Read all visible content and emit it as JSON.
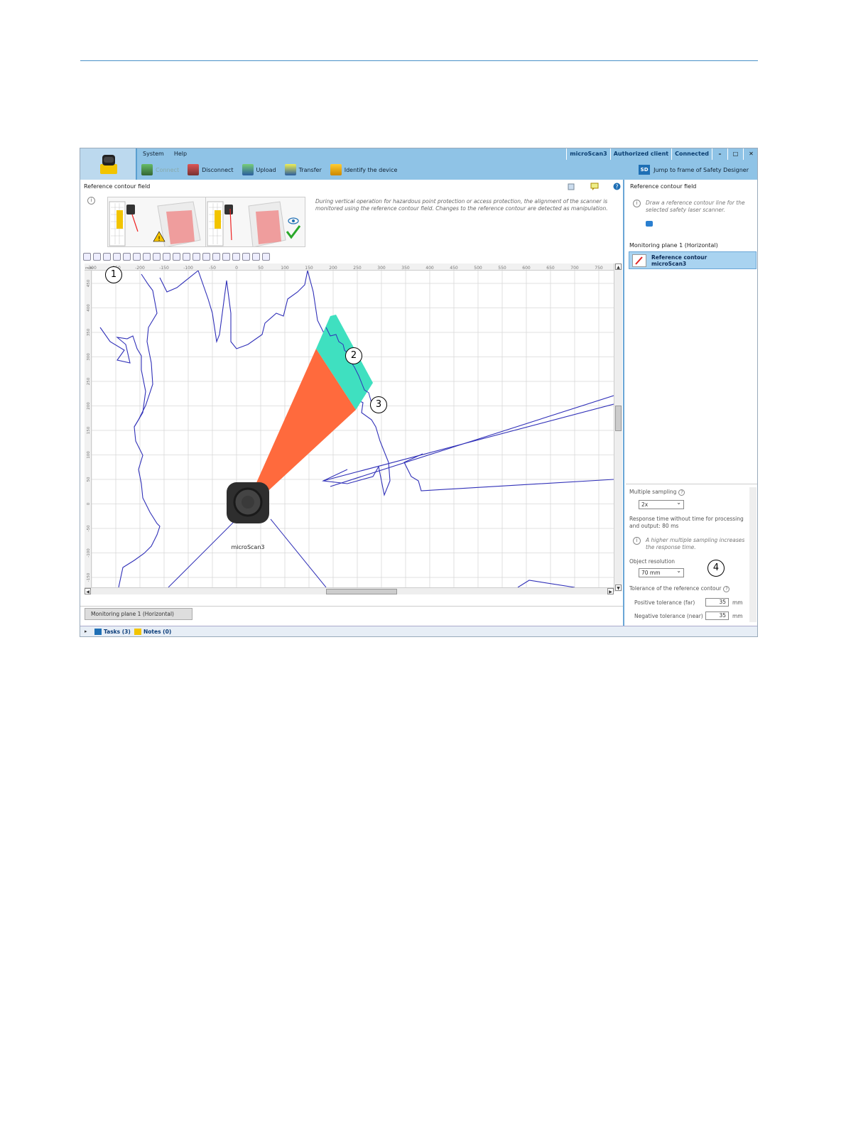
{
  "menu": {
    "system": "System",
    "help": "Help"
  },
  "status": {
    "device": "microScan3",
    "client": "Authorized client",
    "connection": "Connected",
    "minimize": "–",
    "maximize": "□",
    "close": "✕"
  },
  "toolbar": {
    "connect": "Connect",
    "disconnect": "Disconnect",
    "upload": "Upload",
    "transfer": "Transfer",
    "identify": "Identify the device",
    "jump_icon": "SD",
    "jump": "Jump to frame of Safety Designer"
  },
  "left_panel": {
    "title": "Reference contour field",
    "description": "During vertical operation for hazardous point protection or access protection, the alignment of the scanner is monitored using the reference contour field. Changes to the reference contour are detected as manipulation.",
    "ruler_x": [
      "-300",
      "-250",
      "-200",
      "-150",
      "-100",
      "-50",
      "0",
      "50",
      "100",
      "150",
      "200",
      "250",
      "300",
      "350",
      "400",
      "450",
      "500",
      "550",
      "600",
      "650",
      "700",
      "750"
    ],
    "ruler_y": [
      "450",
      "400",
      "350",
      "300",
      "250",
      "200",
      "150",
      "100",
      "50",
      "0",
      "-50",
      "-100",
      "-150"
    ],
    "ruler_unit": "mm",
    "scanner_label": "microScan3",
    "tab": "Monitoring plane 1 (Horizontal)"
  },
  "right_panel": {
    "title": "Reference contour field",
    "info": "Draw a reference contour line for the selected safety laser scanner.",
    "monitoring_plane": "Monitoring plane 1 (Horizontal)",
    "item_line1": "Reference contour",
    "item_line2": "microScan3",
    "multiple_sampling_label": "Multiple sampling",
    "multiple_sampling_value": "2x",
    "response_time": "Response time without time for processing and output: 80 ms",
    "sampling_note": "A higher multiple sampling increases the response time.",
    "object_resolution_label": "Object resolution",
    "object_resolution_value": "70 mm",
    "tolerance_label": "Tolerance of the reference contour",
    "positive_label": "Positive tolerance (far)",
    "positive_value": "35",
    "negative_label": "Negative tolerance (near)",
    "negative_value": "35",
    "unit": "mm"
  },
  "bottom": {
    "tasks": "Tasks (3)",
    "notes": "Notes (0)"
  },
  "callouts": {
    "c1": "1",
    "c2": "2",
    "c3": "3",
    "c4": "4"
  },
  "colors": {
    "accent": "#8fc3e6",
    "field_orange": "#ff6a3d",
    "field_teal": "#3fe0c0",
    "contour_line": "#3030b8"
  }
}
